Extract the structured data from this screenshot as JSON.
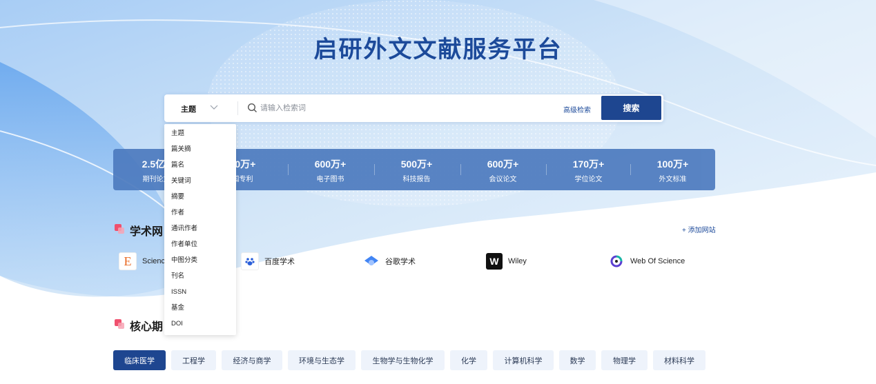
{
  "colors": {
    "brand": "#1e4690",
    "stats_band": "#4d7bbf",
    "accent_mark": "#f0506e",
    "tag_bg": "#eef3fb"
  },
  "header": {
    "title": "启研外文文献服务平台"
  },
  "search": {
    "field_selected": "主题",
    "placeholder": "请输入检索词",
    "advanced_label": "高级检索",
    "button_label": "搜索"
  },
  "field_options": [
    "主题",
    "篇关摘",
    "篇名",
    "关键词",
    "摘要",
    "作者",
    "通讯作者",
    "作者单位",
    "中图分类",
    "刊名",
    "ISSN",
    "基金",
    "DOI"
  ],
  "stats": [
    {
      "value": "2.5亿+",
      "label": "期刊论文"
    },
    {
      "value": "00万+",
      "label": "国专利"
    },
    {
      "value": "600万+",
      "label": "电子图书"
    },
    {
      "value": "500万+",
      "label": "科技报告"
    },
    {
      "value": "600万+",
      "label": "会议论文"
    },
    {
      "value": "170万+",
      "label": "学位论文"
    },
    {
      "value": "100万+",
      "label": "外文标准"
    }
  ],
  "academic_sites": {
    "title": "学术网",
    "add_label": "+ 添加网站",
    "items": [
      {
        "name": "Science",
        "icon": "elsevier-e-icon"
      },
      {
        "name": "百度学术",
        "icon": "baidu-paw-icon"
      },
      {
        "name": "谷歌学术",
        "icon": "google-scholar-icon"
      },
      {
        "name": "Wiley",
        "icon": "wiley-w-icon"
      },
      {
        "name": "Web Of Science",
        "icon": "web-of-science-icon"
      }
    ]
  },
  "core_journals": {
    "title": "核心期",
    "tags": [
      "临床医学",
      "工程学",
      "经济与商学",
      "环境与生态学",
      "生物学与生物化学",
      "化学",
      "计算机科学",
      "数学",
      "物理学",
      "材料科学"
    ],
    "active_tag": "临床医学"
  }
}
